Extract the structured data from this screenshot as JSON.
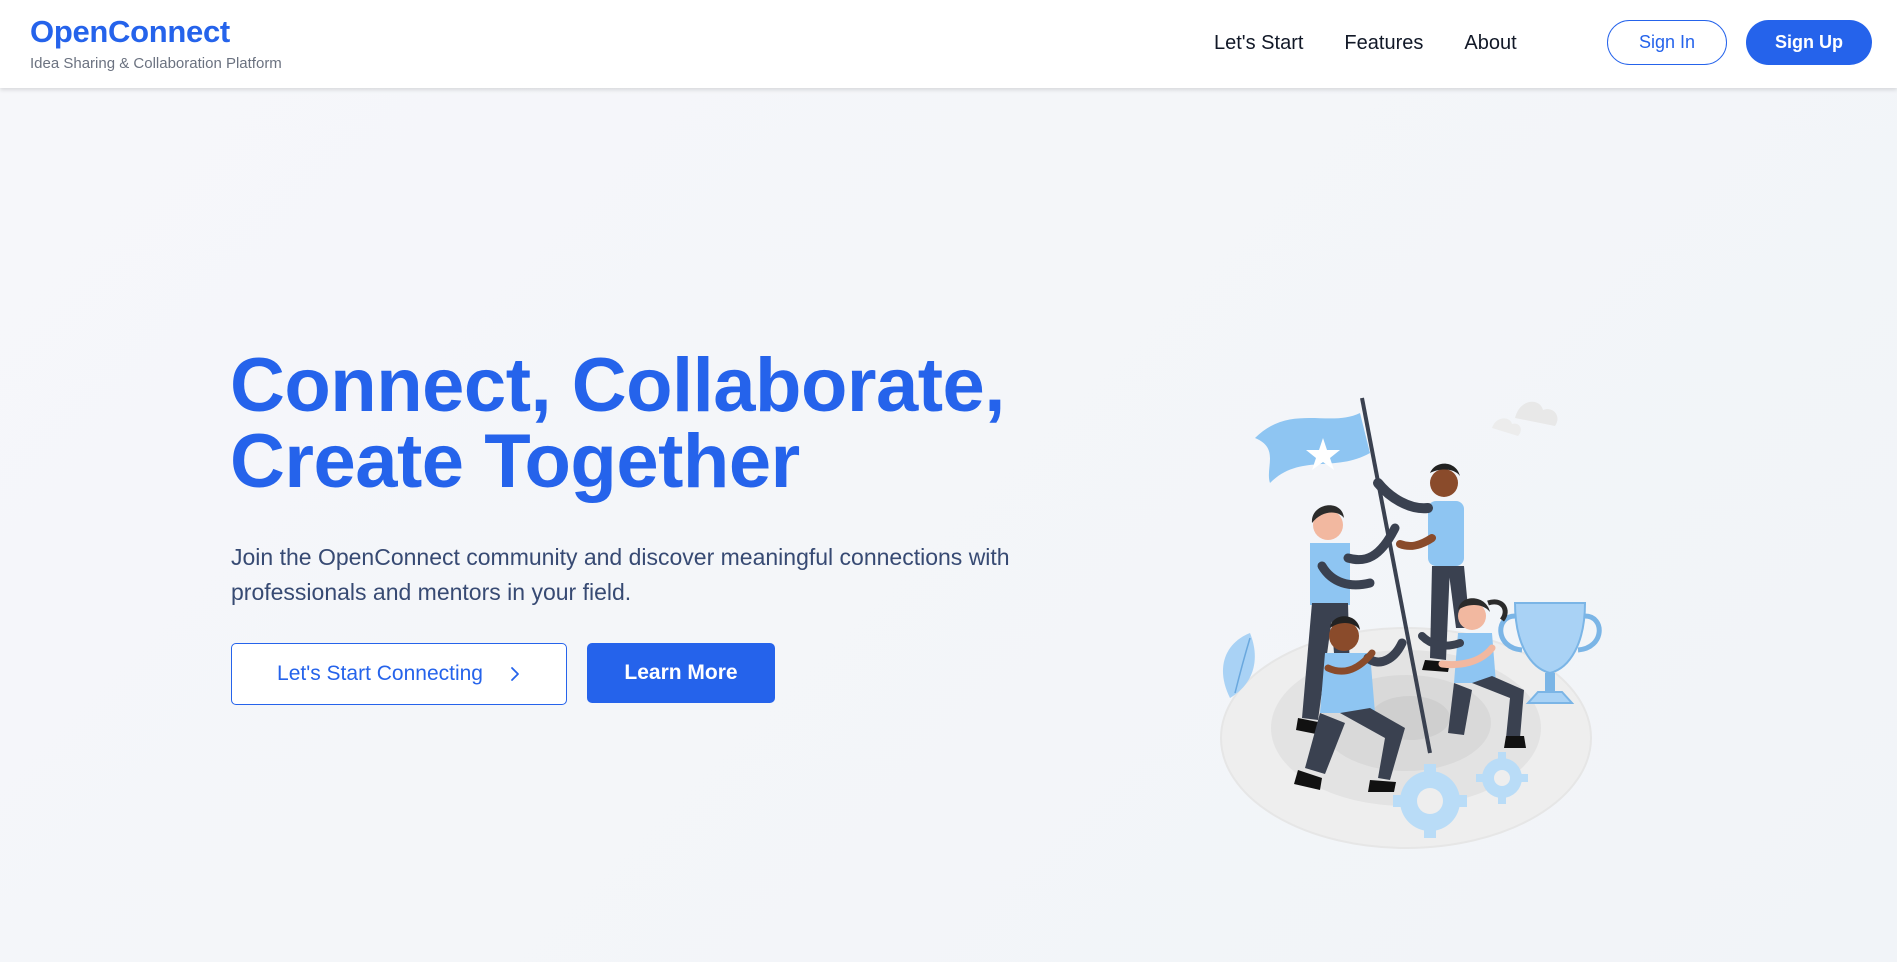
{
  "brand": {
    "name": "OpenConnect",
    "tagline": "Idea Sharing & Collaboration Platform"
  },
  "nav": {
    "links": [
      "Let's Start",
      "Features",
      "About"
    ],
    "sign_in": "Sign In",
    "sign_up": "Sign Up"
  },
  "hero": {
    "headline_line1": "Connect, Collaborate,",
    "headline_line2": "Create Together",
    "subtext": "Join the OpenConnect community and discover meaningful connections with professionals and mentors in your field.",
    "primary_cta": "Let's Start Connecting",
    "secondary_cta": "Learn More",
    "illustration": "team-raising-flag-illustration"
  },
  "colors": {
    "accent": "#2563eb",
    "text_muted": "#6b7280",
    "subtext": "#374a73",
    "background": "#f4f6f9",
    "illustration_blue": "#8ec5f2",
    "illustration_dark": "#3a4150"
  }
}
